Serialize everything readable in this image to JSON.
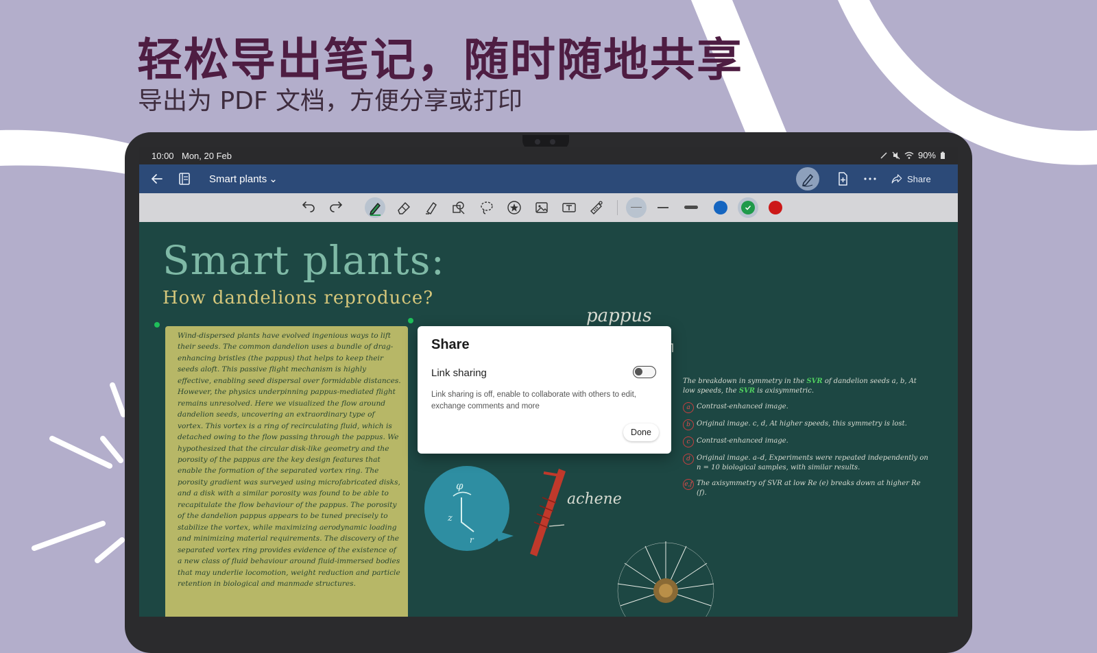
{
  "promo": {
    "headline": "轻松导出笔记，随时随地共享",
    "subheadline": "导出为 PDF 文档，方便分享或打印"
  },
  "statusbar": {
    "time": "10:00",
    "date": "Mon, 20 Feb",
    "battery": "90%"
  },
  "appbar": {
    "title": "Smart plants",
    "title_chevron": "⌄",
    "share_label": "Share",
    "icons": [
      "back-arrow-icon",
      "page-list-icon",
      "pen-mode-icon",
      "add-page-icon",
      "more-icon",
      "share-icon"
    ]
  },
  "toolbar": {
    "tools": [
      "undo-icon",
      "redo-icon",
      "pen-icon",
      "eraser-icon",
      "highlighter-icon",
      "shape-icon",
      "lasso-icon",
      "sticker-icon",
      "image-icon",
      "text-box-icon",
      "ruler-icon"
    ],
    "colors": {
      "blue": "#1565c0",
      "green": "#1f9a4a",
      "red": "#cc1818"
    }
  },
  "note": {
    "title": "Smart plants:",
    "subtitle": "How dandelions reproduce?",
    "body": "Wind-dispersed plants have evolved ingenious ways to lift their seeds. The common dandelion uses a bundle of drag-enhancing bristles (the pappus) that helps to keep their seeds aloft. This passive flight mechanism is highly effective, enabling seed dispersal over formidable distances. However, the physics underpinning pappus-mediated flight remains unresolved. Here we visualized the flow around dandelion seeds, uncovering an extraordinary type of vortex. This vortex is a ring of recirculating fluid, which is detached owing to the flow passing through the pappus. We hypothesized that the circular disk-like geometry and the porosity of the pappus are the key design features that enable the formation of the separated vortex ring. The porosity gradient was surveyed using microfabricated disks, and a disk with a similar porosity was found to be able to recapitulate the flow behaviour of the pappus. The porosity of the dandelion pappus appears to be tuned precisely to stabilize the vortex, while maximizing aerodynamic loading and minimizing material requirements. The discovery of the separated vortex ring provides evidence of the existence of a new class of fluid behaviour around fluid-immersed bodies that may underlie locomotion, weight reduction and particle retention in biological and manmade structures.",
    "label_pappus": "pappus",
    "label_achene": "achene",
    "right_intro_a": "The breakdown in symmetry in the ",
    "right_svr": "SVR",
    "right_intro_b": " of dandelion seeds a, b, At low speeds, the ",
    "right_intro_c": " is axisymmetric.",
    "right_items": [
      {
        "tag": "a",
        "text": "Contrast-enhanced image."
      },
      {
        "tag": "b",
        "text": "Original image. c, d, At higher speeds, this symmetry is lost."
      },
      {
        "tag": "c",
        "text": "Contrast-enhanced image."
      },
      {
        "tag": "d",
        "text": "Original image. a–d, Experiments were repeated independently on n = 10 biological samples, with similar results."
      },
      {
        "tag": "e,f",
        "text": "The axisymmetry of SVR at low Re (e) breaks down at higher Re (f)."
      }
    ]
  },
  "share_dialog": {
    "title": "Share",
    "link_sharing_label": "Link sharing",
    "link_sharing_on": false,
    "description": "Link sharing is off, enable to collaborate with others to edit, exchange comments and more",
    "done_label": "Done"
  }
}
